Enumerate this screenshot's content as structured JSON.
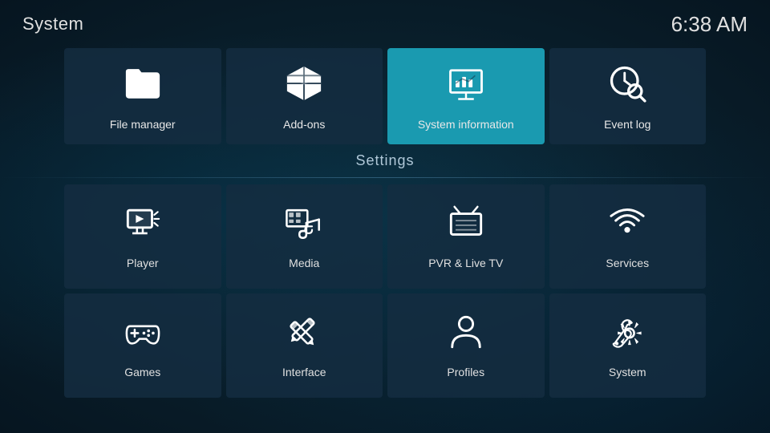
{
  "header": {
    "title": "System",
    "time": "6:38 AM"
  },
  "top_row": [
    {
      "id": "file-manager",
      "label": "File manager",
      "icon": "folder"
    },
    {
      "id": "add-ons",
      "label": "Add-ons",
      "icon": "box"
    },
    {
      "id": "system-information",
      "label": "System information",
      "icon": "chart",
      "active": true
    },
    {
      "id": "event-log",
      "label": "Event log",
      "icon": "clock-search"
    }
  ],
  "settings": {
    "title": "Settings",
    "items_row1": [
      {
        "id": "player",
        "label": "Player",
        "icon": "play"
      },
      {
        "id": "media",
        "label": "Media",
        "icon": "media"
      },
      {
        "id": "pvr-live-tv",
        "label": "PVR & Live TV",
        "icon": "tv"
      },
      {
        "id": "services",
        "label": "Services",
        "icon": "wifi"
      }
    ],
    "items_row2": [
      {
        "id": "games",
        "label": "Games",
        "icon": "gamepad"
      },
      {
        "id": "interface",
        "label": "Interface",
        "icon": "pencil"
      },
      {
        "id": "profiles",
        "label": "Profiles",
        "icon": "person"
      },
      {
        "id": "system",
        "label": "System",
        "icon": "gear"
      }
    ]
  }
}
